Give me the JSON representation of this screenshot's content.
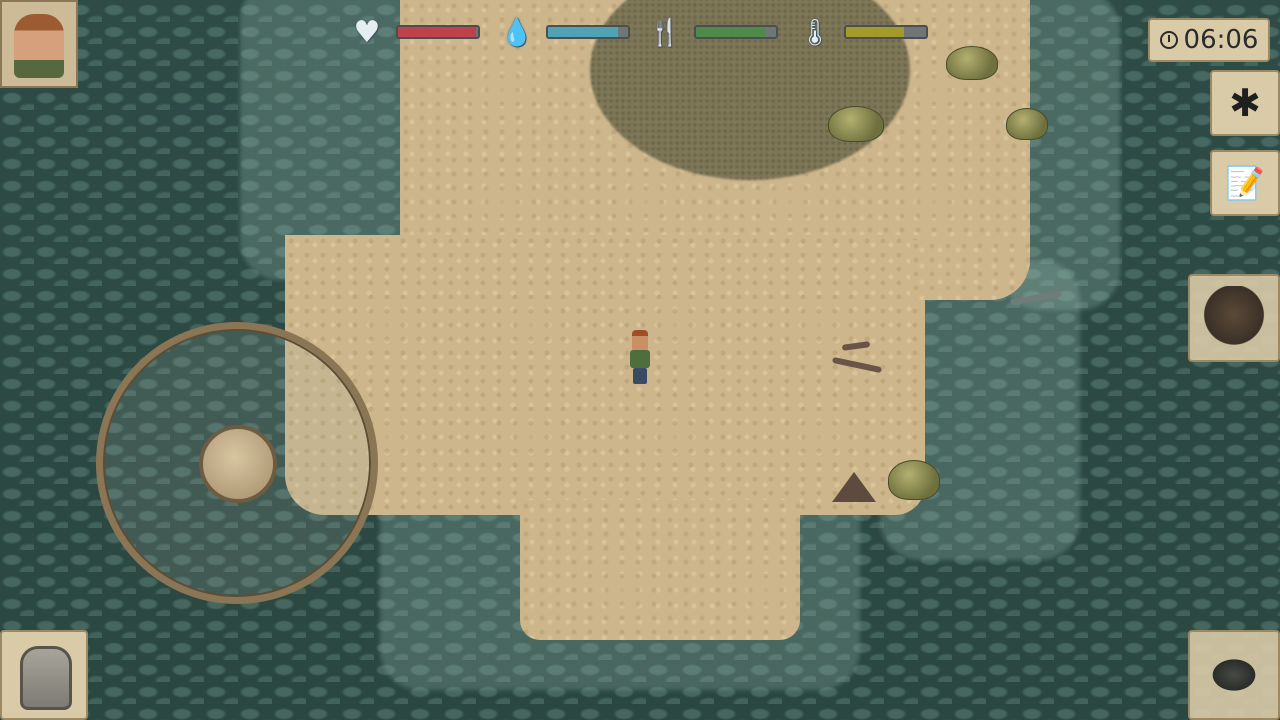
{
  "hud": {
    "clock": {
      "time": "06:06",
      "icon": "clock-icon"
    },
    "stats": [
      {
        "name": "health",
        "icon": "heart-icon",
        "glyph": "♥",
        "level": 0.98,
        "color": "#c0414b"
      },
      {
        "name": "thirst",
        "icon": "water-drop-icon",
        "glyph": "💧",
        "level": 0.88,
        "color": "#4fa3b5"
      },
      {
        "name": "hunger",
        "icon": "fork-knife-icon",
        "glyph": "🍴",
        "level": 0.88,
        "color": "#4f8a4a"
      },
      {
        "name": "temperature",
        "icon": "thermometer-icon",
        "glyph": "🌡",
        "level": 0.72,
        "color": "#a39a2a"
      }
    ],
    "buttons": {
      "settings_glyph": "✱",
      "journal_glyph": "📝"
    }
  }
}
